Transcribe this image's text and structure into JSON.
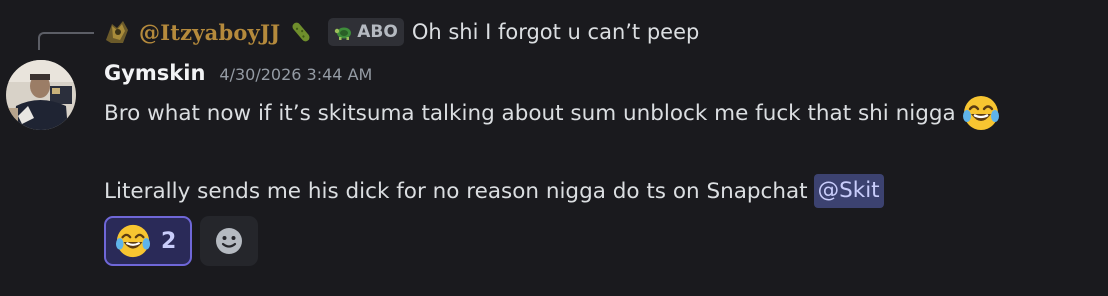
{
  "reply": {
    "author": "@ItzyaboyJJ",
    "tag": "ABO",
    "text": "Oh shi I forgot u can’t peep",
    "pickle_icon": "pickle-emoji",
    "tag_icon": "turtle-clan-icon"
  },
  "message": {
    "author": "Gymskin",
    "timestamp": "4/30/2026 3:44 AM",
    "line1": "Bro what now if it’s skitsuma talking about sum unblock me fuck that shi nigga",
    "line1_emoji": "joy-emoji",
    "line2": "Literally sends me his dick for no reason nigga do ts on Snapchat",
    "mention": "@Skit"
  },
  "reactions": [
    {
      "emoji": "joy-emoji",
      "count": "2"
    }
  ],
  "add_reaction": {
    "icon": "smiley-face-icon"
  },
  "colors": {
    "background": "#1a1a1e",
    "reply_author": "#b58a3c",
    "mention_bg": "#3c4270",
    "reaction_border": "#6f67d8"
  }
}
